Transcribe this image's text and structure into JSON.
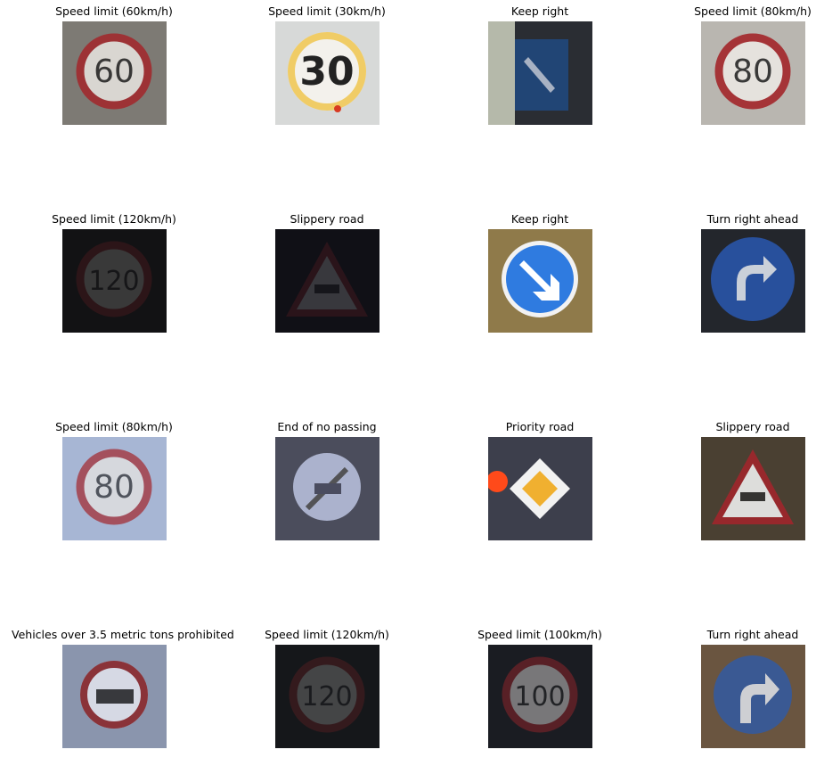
{
  "grid": {
    "items": [
      {
        "label": "Speed limit (60km/h)",
        "sign": "speed",
        "value": "60",
        "bg": "#7d7a74",
        "bright": 0.85
      },
      {
        "label": "Speed limit (30km/h)",
        "sign": "speed-yellow",
        "value": "30",
        "bg": "#d7d9d8",
        "bright": 1.0
      },
      {
        "label": "Keep right",
        "sign": "keep-right-dark",
        "value": "",
        "bg": "#2a2d33",
        "bright": 0.8
      },
      {
        "label": "Speed limit (80km/h)",
        "sign": "speed",
        "value": "80",
        "bg": "#b9b6b0",
        "bright": 0.9
      },
      {
        "label": "Speed limit (120km/h)",
        "sign": "speed",
        "value": "120",
        "bg": "#121214",
        "bright": 0.18
      },
      {
        "label": "Slippery road",
        "sign": "triangle",
        "value": "",
        "bg": "#101016",
        "bright": 0.18
      },
      {
        "label": "Keep right",
        "sign": "keep-right",
        "value": "",
        "bg": "#8f7a4a",
        "bright": 1.0
      },
      {
        "label": "Turn right ahead",
        "sign": "turn-right-ahead",
        "value": "",
        "bg": "#23262c",
        "bright": 0.85
      },
      {
        "label": "Speed limit (80km/h)",
        "sign": "speed",
        "value": "80",
        "bg": "#a7b6d4",
        "bright": 0.7
      },
      {
        "label": "End of no passing",
        "sign": "end-no-passing",
        "value": "",
        "bg": "#4b4d5c",
        "bright": 0.8
      },
      {
        "label": "Priority road",
        "sign": "priority",
        "value": "",
        "bg": "#3d3f4c",
        "bright": 1.0
      },
      {
        "label": "Slippery road",
        "sign": "triangle",
        "value": "",
        "bg": "#4a4032",
        "bright": 0.9
      },
      {
        "label": "Vehicles over 3.5 metric tons prohibited",
        "sign": "no-trucks",
        "value": "",
        "bg": "#8a95ad",
        "bright": 0.85
      },
      {
        "label": "Speed limit (120km/h)",
        "sign": "speed",
        "value": "120",
        "bg": "#15171a",
        "bright": 0.22
      },
      {
        "label": "Speed limit (100km/h)",
        "sign": "speed",
        "value": "100",
        "bg": "#1a1c22",
        "bright": 0.45
      },
      {
        "label": "Turn right ahead",
        "sign": "turn-right",
        "value": "",
        "bg": "#6a5540",
        "bright": 0.8
      }
    ]
  }
}
